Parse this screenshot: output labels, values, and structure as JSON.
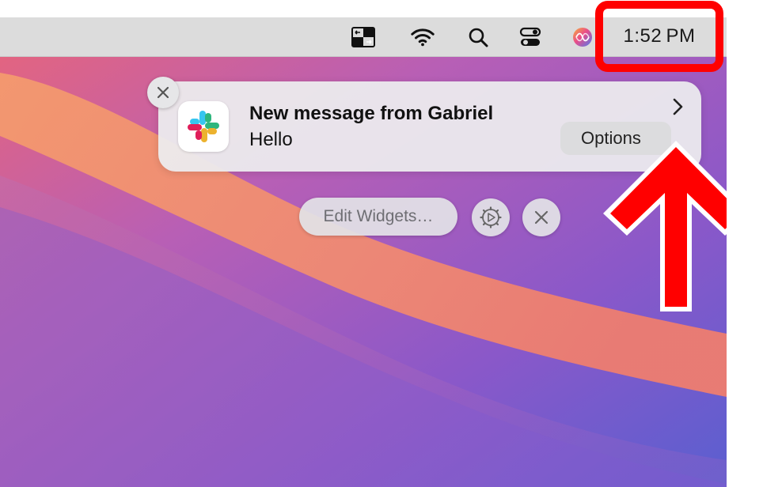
{
  "menubar": {
    "icons": [
      "window-switcher-icon",
      "wifi-icon",
      "spotlight-search-icon",
      "control-center-icon",
      "siri-icon"
    ],
    "clock": "1:52 PM"
  },
  "notification": {
    "app_icon": "slack-icon",
    "title": "New message from Gabriel",
    "body": "Hello",
    "options_label": "Options",
    "close_icon": "close-icon",
    "expand_icon": "chevron-right-icon"
  },
  "widgets_bar": {
    "edit_label": "Edit Widgets…",
    "settings_icon": "gear-play-icon",
    "close_icon": "close-icon"
  },
  "annotation": {
    "highlight_color": "#ff0000",
    "arrow_color": "#ff0000"
  }
}
